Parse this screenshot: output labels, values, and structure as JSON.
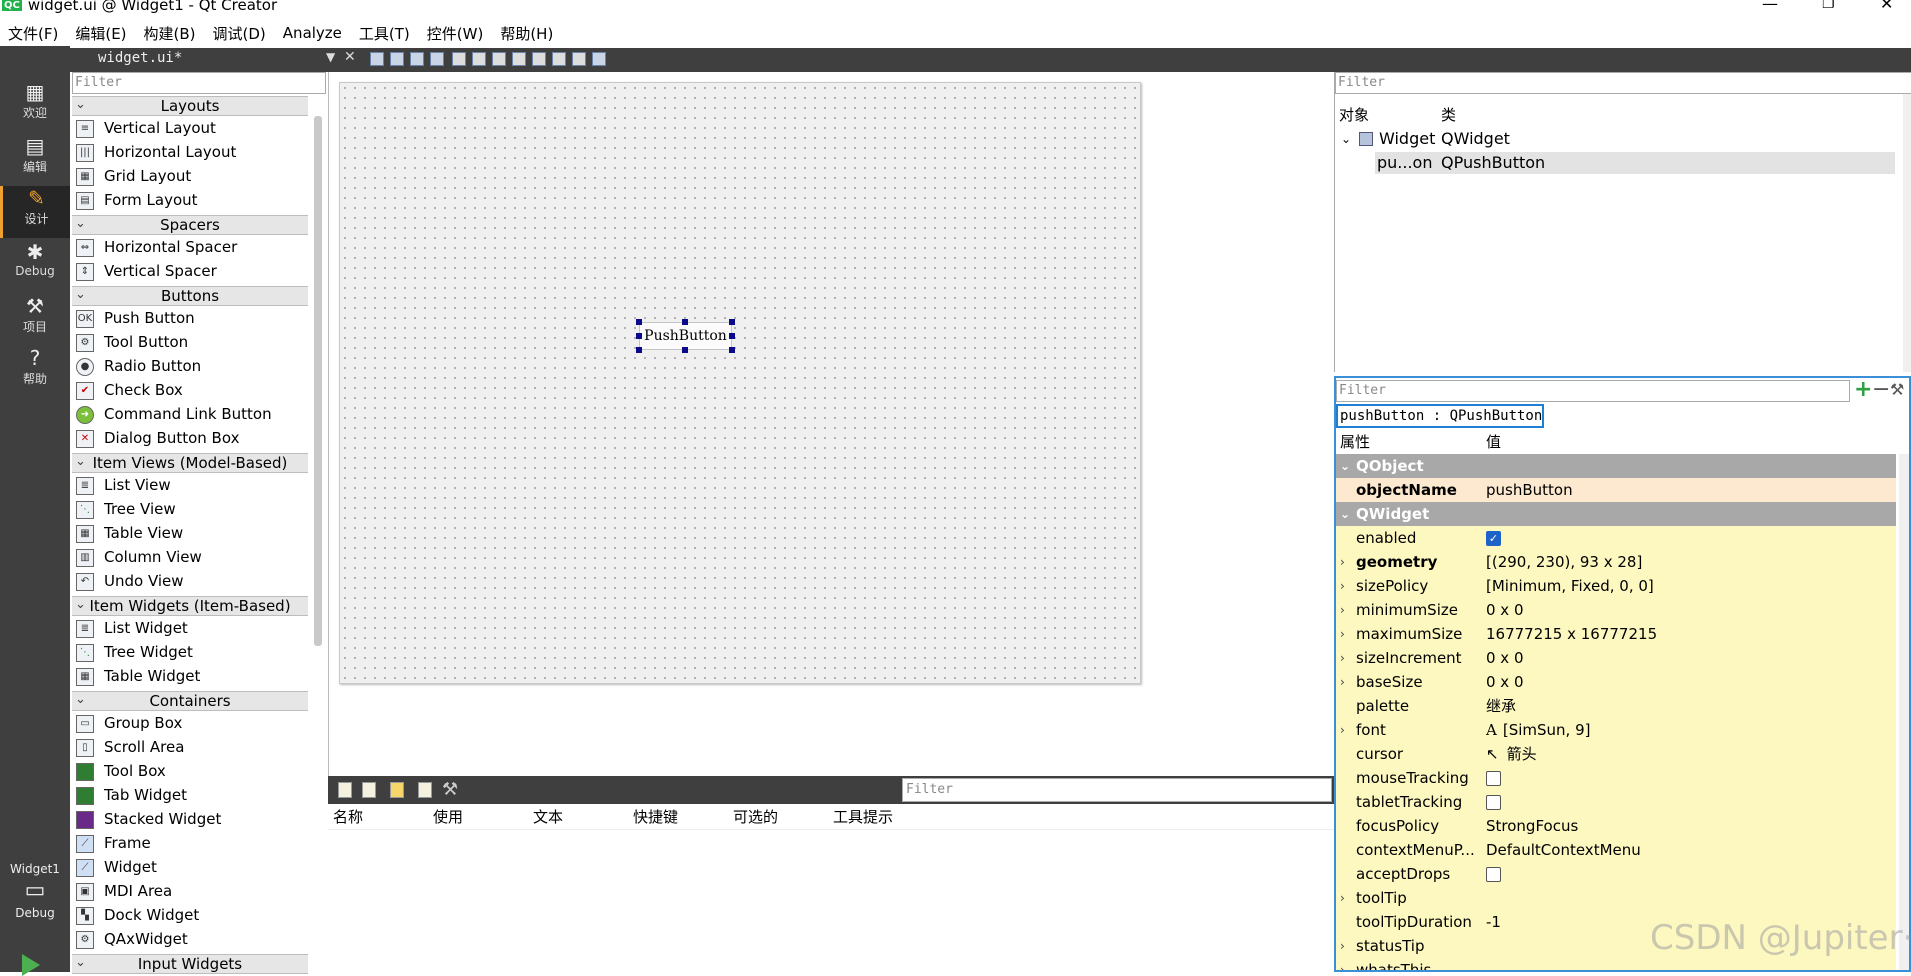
{
  "titlebar": {
    "logo": "QC",
    "title": "widget.ui @ Widget1 - Qt Creator",
    "minimize": "—",
    "maximize": "❐",
    "close": "✕"
  },
  "menubar": [
    "文件(F)",
    "编辑(E)",
    "构建(B)",
    "调试(D)",
    "Analyze",
    "工具(T)",
    "控件(W)",
    "帮助(H)"
  ],
  "modes": [
    {
      "label": "欢迎",
      "icon": "grid-icon"
    },
    {
      "label": "编辑",
      "icon": "document-icon"
    },
    {
      "label": "设计",
      "icon": "pencil-icon"
    },
    {
      "label": "Debug",
      "icon": "bug-icon"
    },
    {
      "label": "项目",
      "icon": "wrench-icon"
    },
    {
      "label": "帮助",
      "icon": "help-icon"
    }
  ],
  "kit": {
    "project": "Widget1",
    "config": "Debug"
  },
  "editor": {
    "document": "widget.ui*"
  },
  "widgetbox": {
    "filter_placeholder": "Filter",
    "categories": [
      "Layouts",
      "Spacers",
      "Buttons",
      "Item Views (Model-Based)",
      "Item Widgets (Item-Based)",
      "Containers",
      "Input Widgets"
    ],
    "items": {
      "layouts": [
        "Vertical Layout",
        "Horizontal Layout",
        "Grid Layout",
        "Form Layout"
      ],
      "spacers": [
        "Horizontal Spacer",
        "Vertical Spacer"
      ],
      "buttons": [
        "Push Button",
        "Tool Button",
        "Radio Button",
        "Check Box",
        "Command Link Button",
        "Dialog Button Box"
      ],
      "item_views": [
        "List View",
        "Tree View",
        "Table View",
        "Column View",
        "Undo View"
      ],
      "item_widgets": [
        "List Widget",
        "Tree Widget",
        "Table Widget"
      ],
      "containers": [
        "Group Box",
        "Scroll Area",
        "Tool Box",
        "Tab Widget",
        "Stacked Widget",
        "Frame",
        "Widget",
        "MDI Area",
        "Dock Widget",
        "QAxWidget"
      ]
    }
  },
  "form": {
    "button_text": "PushButton"
  },
  "action_editor": {
    "filter_placeholder": "Filter",
    "columns": [
      "名称",
      "使用",
      "文本",
      "快捷键",
      "可选的",
      "工具提示"
    ]
  },
  "object_inspector": {
    "filter_placeholder": "Filter",
    "columns": [
      "对象",
      "类"
    ],
    "rows": [
      {
        "object": "Widget",
        "class": "QWidget"
      },
      {
        "object": "pu...on",
        "class": "QPushButton"
      }
    ]
  },
  "property_editor": {
    "filter_placeholder": "Filter",
    "class_label": "pushButton : QPushButton",
    "columns": [
      "属性",
      "值"
    ],
    "groups": {
      "qobject": "QObject",
      "qwidget": "QWidget"
    },
    "props": {
      "objectName": {
        "k": "objectName",
        "v": "pushButton"
      },
      "enabled": {
        "k": "enabled",
        "checked": true
      },
      "geometry": {
        "k": "geometry",
        "v": "[(290, 230), 93 x 28]"
      },
      "sizePolicy": {
        "k": "sizePolicy",
        "v": "[Minimum, Fixed, 0, 0]"
      },
      "minimumSize": {
        "k": "minimumSize",
        "v": "0 x 0"
      },
      "maximumSize": {
        "k": "maximumSize",
        "v": "16777215 x 16777215"
      },
      "sizeIncrement": {
        "k": "sizeIncrement",
        "v": "0 x 0"
      },
      "baseSize": {
        "k": "baseSize",
        "v": "0 x 0"
      },
      "palette": {
        "k": "palette",
        "v": "继承"
      },
      "font": {
        "k": "font",
        "v": "[SimSun, 9]",
        "glyph": "A"
      },
      "cursor": {
        "k": "cursor",
        "v": "箭头"
      },
      "mouseTracking": {
        "k": "mouseTracking",
        "checked": false
      },
      "tabletTracking": {
        "k": "tabletTracking",
        "checked": false
      },
      "focusPolicy": {
        "k": "focusPolicy",
        "v": "StrongFocus"
      },
      "contextMenuPolicy": {
        "k": "contextMenuP...",
        "v": "DefaultContextMenu"
      },
      "acceptDrops": {
        "k": "acceptDrops",
        "checked": false
      },
      "toolTip": {
        "k": "toolTip",
        "v": ""
      },
      "toolTipDuration": {
        "k": "toolTipDuration",
        "v": "-1"
      },
      "statusTip": {
        "k": "statusTip",
        "v": ""
      },
      "whatsThis": {
        "k": "whatsThis",
        "v": ""
      }
    }
  },
  "watermark": "CSDN @Jupiter·"
}
